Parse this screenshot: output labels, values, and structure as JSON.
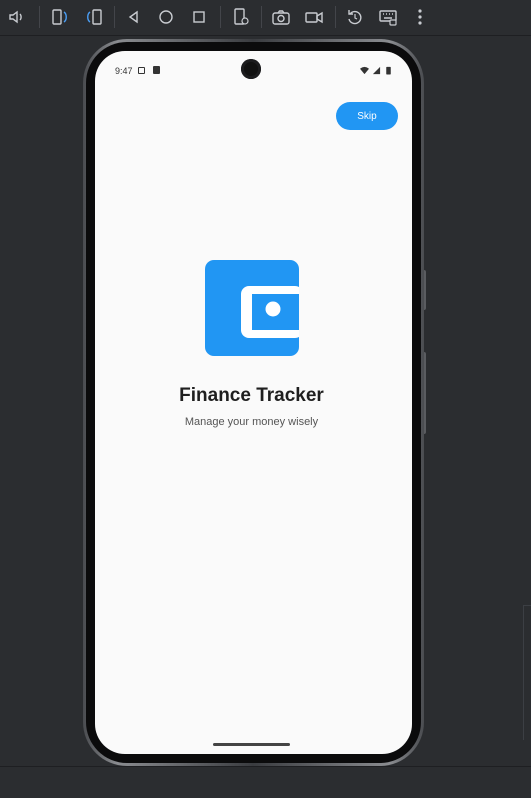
{
  "toolbar": {
    "icons": [
      "volume-icon",
      "rotate-left-icon",
      "rotate-right-icon",
      "back-icon",
      "home-icon",
      "overview-icon",
      "device-settings-icon",
      "camera-icon",
      "video-icon",
      "reset-icon",
      "keyboard-icon",
      "more-icon"
    ]
  },
  "status_bar": {
    "time": "9:47"
  },
  "screen": {
    "skip_label": "Skip",
    "title": "Finance Tracker",
    "subtitle": "Manage your money wisely",
    "accent_color": "#2196f3"
  }
}
